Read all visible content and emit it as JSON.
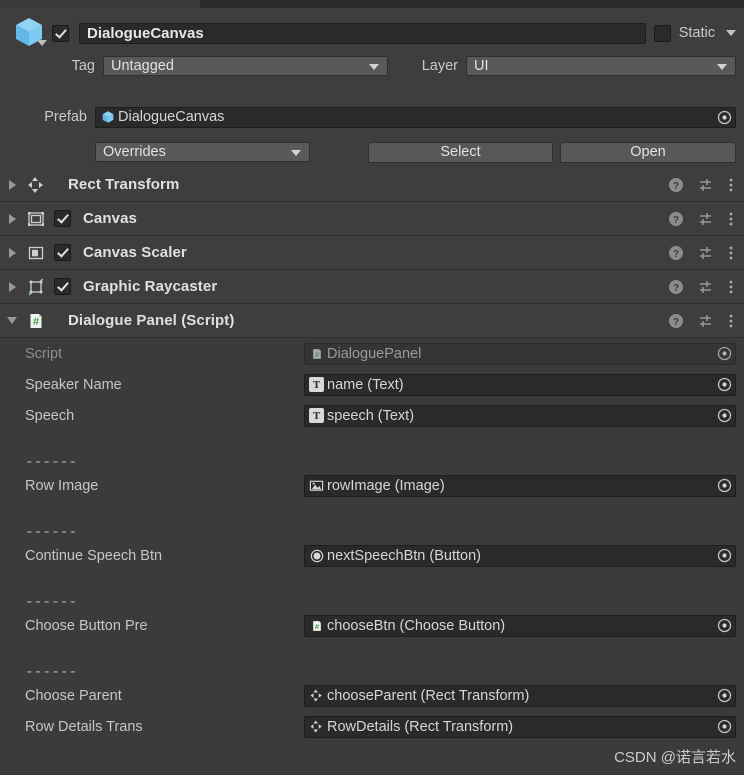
{
  "window": {
    "active_tab_placeholder": "inspector-tab"
  },
  "header": {
    "gameobject_icon": "prefab-cube-icon",
    "active_checkbox_checked": true,
    "name": "DialogueCanvas",
    "static_checkbox_checked": false,
    "static_label": "Static",
    "tag_label": "Tag",
    "tag_value": "Untagged",
    "layer_label": "Layer",
    "layer_value": "UI",
    "prefab_label": "Prefab",
    "prefab_value": "DialogueCanvas",
    "overrides_label": "Overrides",
    "select_label": "Select",
    "open_label": "Open"
  },
  "components": [
    {
      "name": "Rect Transform",
      "icon": "rect-transform-icon",
      "expanded": false,
      "has_enable_checkbox": false,
      "enabled": false
    },
    {
      "name": "Canvas",
      "icon": "canvas-icon",
      "expanded": false,
      "has_enable_checkbox": true,
      "enabled": true
    },
    {
      "name": "Canvas Scaler",
      "icon": "canvas-scaler-icon",
      "expanded": false,
      "has_enable_checkbox": true,
      "enabled": true
    },
    {
      "name": "Graphic Raycaster",
      "icon": "graphic-raycaster-icon",
      "expanded": false,
      "has_enable_checkbox": true,
      "enabled": true
    },
    {
      "name": "Dialogue Panel (Script)",
      "icon": "cs-script-icon",
      "expanded": true,
      "has_enable_checkbox": false,
      "enabled": false
    }
  ],
  "component_icons": {
    "help": "help-icon",
    "preset": "preset-sliders-icon",
    "menu": "kebab-menu-icon"
  },
  "script_properties": [
    {
      "kind": "field",
      "label": "Script",
      "label_dim": true,
      "value": "DialoguePanel",
      "value_icon": "cs-script-icon",
      "readonly": true
    },
    {
      "kind": "field",
      "label": "Speaker Name",
      "label_dim": false,
      "value": "name (Text)",
      "value_icon": "text-component-icon",
      "readonly": false
    },
    {
      "kind": "field",
      "label": "Speech",
      "label_dim": false,
      "value": "speech (Text)",
      "value_icon": "text-component-icon",
      "readonly": false
    },
    {
      "kind": "gap"
    },
    {
      "kind": "separator",
      "dashes": "------"
    },
    {
      "kind": "field",
      "label": "Row Image",
      "label_dim": false,
      "value": "rowImage (Image)",
      "value_icon": "image-component-icon",
      "readonly": false
    },
    {
      "kind": "gap"
    },
    {
      "kind": "separator",
      "dashes": "------"
    },
    {
      "kind": "field",
      "label": "Continue Speech Btn",
      "label_dim": false,
      "value": "nextSpeechBtn (Button)",
      "value_icon": "button-component-icon",
      "readonly": false
    },
    {
      "kind": "gap"
    },
    {
      "kind": "separator",
      "dashes": "------"
    },
    {
      "kind": "field",
      "label": "Choose Button Pre",
      "label_dim": false,
      "value": "chooseBtn (Choose Button)",
      "value_icon": "cs-script-icon",
      "readonly": false
    },
    {
      "kind": "gap"
    },
    {
      "kind": "separator",
      "dashes": "------"
    },
    {
      "kind": "field",
      "label": "Choose Parent",
      "label_dim": false,
      "value": "chooseParent (Rect Transform)",
      "value_icon": "rect-transform-icon",
      "readonly": false
    },
    {
      "kind": "field",
      "label": "Row Details Trans",
      "label_dim": false,
      "value": "RowDetails (Rect Transform)",
      "value_icon": "rect-transform-icon",
      "readonly": false
    }
  ],
  "object_picker_icon": "object-picker-icon",
  "watermark": "CSDN @诺言若水",
  "colors": {
    "panel_bg": "#3b3b3b",
    "header_bg": "#3e3e3e",
    "field_bg": "#2a2a2a",
    "button_bg": "#585858",
    "text": "#c4c4c4",
    "prefab_blue": "#6dc0e8",
    "script_green": "#3fa34b"
  }
}
